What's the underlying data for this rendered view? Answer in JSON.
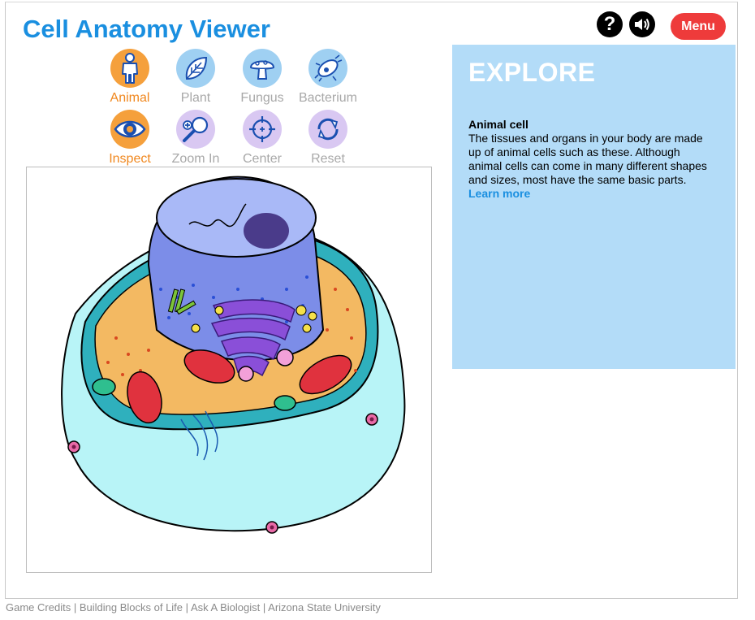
{
  "app": {
    "title": "Cell Anatomy Viewer"
  },
  "header": {
    "help_symbol": "?",
    "menu_label": "Menu"
  },
  "cell_types": [
    {
      "label": "Animal",
      "icon": "person-icon",
      "active": true
    },
    {
      "label": "Plant",
      "icon": "leaf-icon",
      "active": false
    },
    {
      "label": "Fungus",
      "icon": "mushroom-icon",
      "active": false
    },
    {
      "label": "Bacterium",
      "icon": "bacterium-icon",
      "active": false
    }
  ],
  "tools": [
    {
      "label": "Inspect",
      "icon": "eye-icon",
      "active": true
    },
    {
      "label": "Zoom In",
      "icon": "zoom-in-icon",
      "active": false
    },
    {
      "label": "Center",
      "icon": "crosshair-icon",
      "active": false
    },
    {
      "label": "Reset",
      "icon": "reset-icon",
      "active": false
    }
  ],
  "explore": {
    "heading": "EXPLORE",
    "subheading": "Animal cell",
    "text": "The tissues and organs in your body are made up of animal cells such as these. Although animal cells can come in many different shapes and sizes, most have the same basic parts.",
    "link": "Learn more"
  },
  "footer": {
    "links": [
      "Game Credits",
      "Building Blocks of Life",
      "Ask A Biologist",
      "Arizona State University"
    ],
    "separator": "|"
  },
  "colors": {
    "title": "#1a8fe0",
    "active_tool": "#f5a03c",
    "menu_button": "#ee3b3b",
    "explore_panel": "#b3dcf8"
  }
}
